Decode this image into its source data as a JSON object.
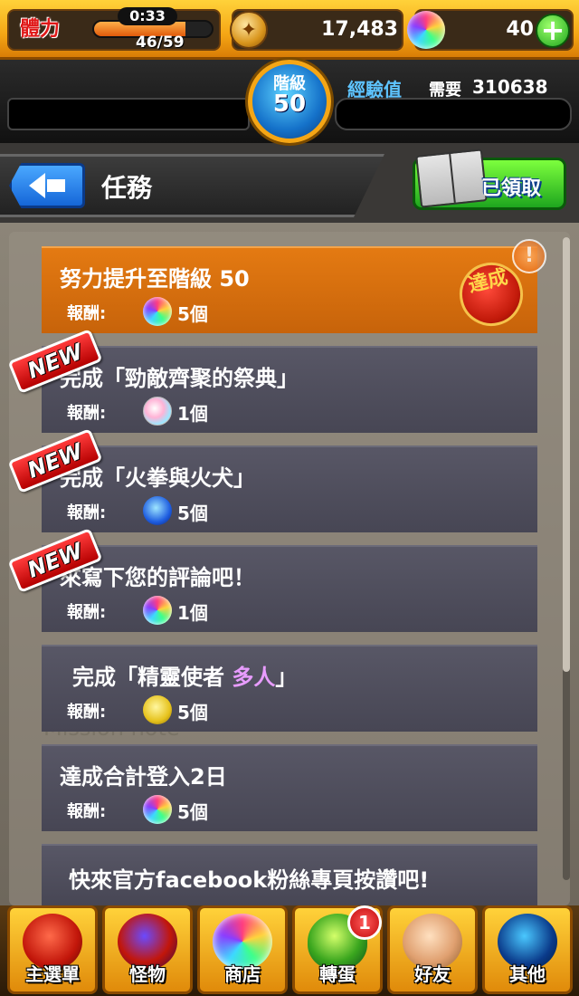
{
  "status_bar": {
    "stamina_label": "體力",
    "stamina_timer": "0:33",
    "stamina_count": "46/59",
    "stamina_fraction": 0.78,
    "coins": "17,483",
    "orbs": "40",
    "plus_label": "+"
  },
  "rank": {
    "label": "階級",
    "value": "50",
    "exp_label": "經驗值",
    "exp_need_label": "需要",
    "exp_need_value": "310638"
  },
  "header": {
    "title": "任務",
    "claimed_label": "已領取"
  },
  "alert_badge": "!",
  "reward_label": "報酬:",
  "watermark": "Mission note",
  "missions": [
    {
      "title": "努力提升至階級 50",
      "reward": "5個",
      "stamp": "達成",
      "new": ""
    },
    {
      "title": "完成「勁敵齊聚的祭典」",
      "reward": "1個",
      "new": "NEW"
    },
    {
      "title": "完成「火拳與火犬」",
      "reward": "5個",
      "new": "NEW"
    },
    {
      "title": "來寫下您的評論吧！",
      "reward": "1個",
      "new": "NEW"
    },
    {
      "title_pre": "完成「精靈使者 ",
      "title_hl": "多人",
      "title_post": "」",
      "reward": "5個",
      "new": ""
    },
    {
      "title": "達成合計登入2日",
      "reward": "5個",
      "new": ""
    },
    {
      "title": "快來官方facebook粉絲專頁按讚吧!",
      "reward": "",
      "new": ""
    }
  ],
  "bottom_nav": [
    {
      "label": "主選單",
      "icon": "red-monster-icon"
    },
    {
      "label": "怪物",
      "icon": "dragon-icon"
    },
    {
      "label": "商店",
      "icon": "orb-icon"
    },
    {
      "label": "轉蛋",
      "icon": "egg-icon",
      "badge": "1"
    },
    {
      "label": "好友",
      "icon": "handshake-icon"
    },
    {
      "label": "其他",
      "icon": "radar-icon"
    }
  ],
  "colors": {
    "accent_orange": "#e47a12",
    "mission_bg": "#585766",
    "highlight_purple": "#e89cff"
  }
}
